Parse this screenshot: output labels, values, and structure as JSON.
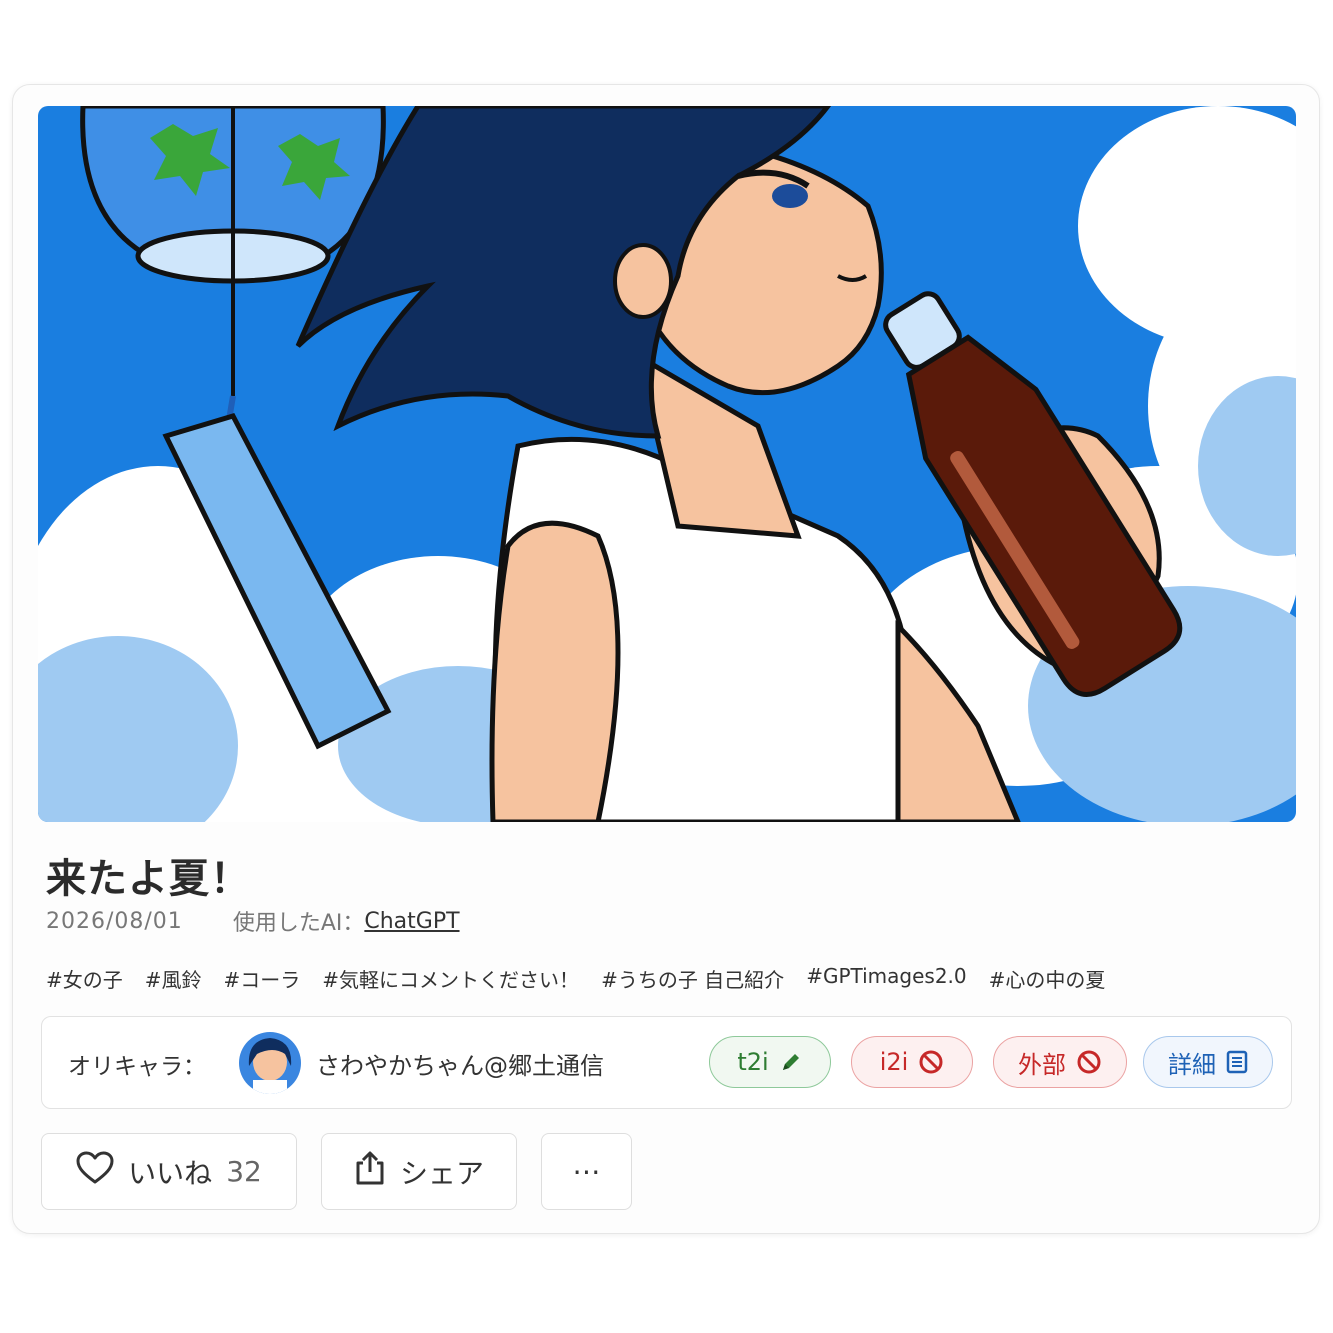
{
  "post": {
    "title": "来たよ夏！",
    "date": "2026/08/01",
    "ai_label": "使用したAI：",
    "ai_name": "ChatGPT",
    "tags": [
      "#女の子",
      "#風鈴",
      "#コーラ",
      "#気軽にコメントください！",
      "#うちの子 自己紹介",
      "#GPTimages2.0",
      "#心の中の夏"
    ]
  },
  "character": {
    "label": "オリキャラ：",
    "name": "さわやかちゃん@郷土通信",
    "badges": {
      "t2i": "t2i",
      "i2i": "i2i",
      "external": "外部",
      "detail": "詳細"
    }
  },
  "actions": {
    "like_label": "いいね",
    "like_count": "32",
    "share_label": "シェア",
    "more_label": "⋯"
  },
  "icons": {
    "like": "heart-icon",
    "share": "share-icon",
    "t2i": "pencil-icon",
    "i2i": "prohibited-icon",
    "external": "prohibited-icon",
    "detail": "document-icon",
    "more": "more-icon"
  },
  "colors": {
    "t2i": "#2e7d32",
    "prohibited": "#c62828",
    "detail": "#1e62b6",
    "sky": "#1a7ee0",
    "hair": "#0f2d5e"
  }
}
